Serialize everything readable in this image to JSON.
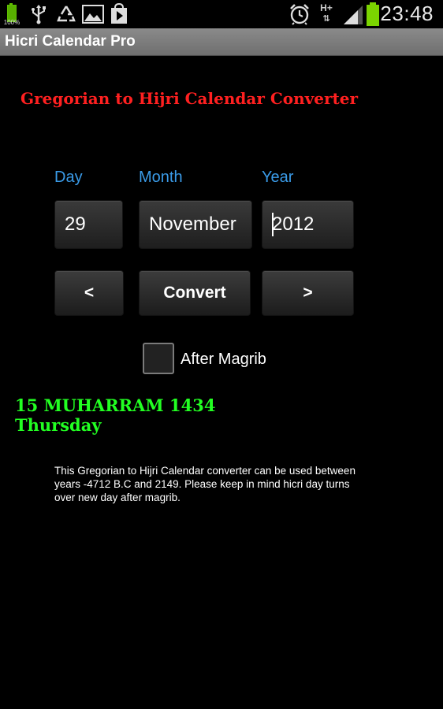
{
  "status_bar": {
    "battery_percent": "100%",
    "network_type": "H+",
    "time": "23:48",
    "icons": [
      "battery-icon",
      "usb-icon",
      "recycle-icon",
      "image-icon",
      "play-store-icon",
      "alarm-icon",
      "network-icon",
      "signal-icon",
      "battery-full-icon"
    ],
    "battery_color": "#58b000"
  },
  "titlebar": {
    "title": "Hicri Calendar Pro"
  },
  "main": {
    "heading": "Gregorian to Hijri Calendar Converter",
    "labels": {
      "day": "Day",
      "month": "Month",
      "year": "Year"
    },
    "values": {
      "day": "29",
      "month": "November",
      "year": "2012"
    },
    "buttons": {
      "prev": "<",
      "convert": "Convert",
      "next": ">"
    },
    "after_magrib_label": "After Magrib",
    "after_magrib_checked": false,
    "result": {
      "date": "15 MUHARRAM 1434",
      "weekday": "Thursday"
    },
    "info": "This Gregorian to Hijri Calendar converter can be used between years -4712 B.C and 2149. Please keep in mind hicri day turns over new day after magrib."
  },
  "colors": {
    "heading": "#ff2020",
    "label": "#3a9be8",
    "result": "#22ff22",
    "titlebar": "#7a7a7a"
  }
}
